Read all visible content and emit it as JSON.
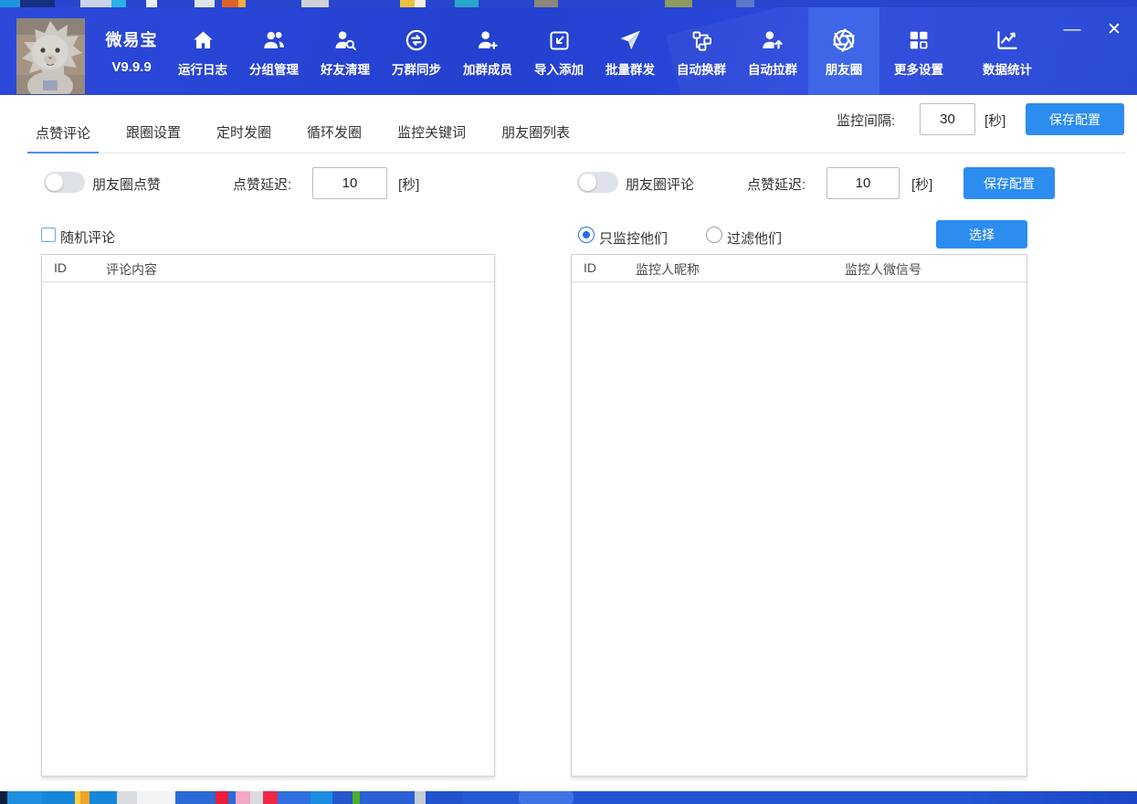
{
  "app": {
    "name": "微易宝",
    "version": "V9.9.9"
  },
  "window_controls": {
    "minimize": "—",
    "close": "✕"
  },
  "nav": {
    "items": [
      {
        "label": "运行日志",
        "icon": "home-icon",
        "active": false
      },
      {
        "label": "分组管理",
        "icon": "users-icon",
        "active": false
      },
      {
        "label": "好友清理",
        "icon": "user-search-icon",
        "active": false
      },
      {
        "label": "万群同步",
        "icon": "sync-icon",
        "active": false
      },
      {
        "label": "加群成员",
        "icon": "user-add-icon",
        "active": false
      },
      {
        "label": "导入添加",
        "icon": "import-icon",
        "active": false
      },
      {
        "label": "批量群发",
        "icon": "send-icon",
        "active": false
      },
      {
        "label": "自动换群",
        "icon": "nodes-icon",
        "active": false
      },
      {
        "label": "自动拉群",
        "icon": "user-up-icon",
        "active": false
      },
      {
        "label": "朋友圈",
        "icon": "aperture-icon",
        "active": true
      },
      {
        "label": "更多设置",
        "icon": "grid-icon",
        "active": false
      },
      {
        "label": "数据统计",
        "icon": "chart-icon",
        "active": false
      }
    ]
  },
  "tabs": [
    {
      "label": "点赞评论",
      "active": true
    },
    {
      "label": "跟圈设置",
      "active": false
    },
    {
      "label": "定时发圈",
      "active": false
    },
    {
      "label": "循环发圈",
      "active": false
    },
    {
      "label": "监控关键词",
      "active": false
    },
    {
      "label": "朋友圈列表",
      "active": false
    }
  ],
  "monitor_interval": {
    "label": "监控间隔:",
    "value": "30",
    "unit": "[秒]",
    "save_button": "保存配置"
  },
  "like_panel": {
    "toggle_label": "朋友圈点赞",
    "toggle_on": false,
    "delay_label": "点赞延迟:",
    "delay_value": "10",
    "delay_unit": "[秒]",
    "random_comment_label": "随机评论",
    "random_comment_checked": false,
    "table": {
      "columns": [
        "ID",
        "评论内容"
      ],
      "rows": []
    }
  },
  "comment_panel": {
    "toggle_label": "朋友圈评论",
    "toggle_on": false,
    "delay_label": "点赞延迟:",
    "delay_value": "10",
    "delay_unit": "[秒]",
    "save_button": "保存配置",
    "radio_options": [
      {
        "label": "只监控他们",
        "selected": true
      },
      {
        "label": "过滤他们",
        "selected": false
      }
    ],
    "select_button": "选择",
    "table": {
      "columns": [
        "ID",
        "监控人昵称",
        "监控人微信号"
      ],
      "rows": []
    }
  },
  "colors": {
    "header_blue": "#2845d8",
    "nav_active_blue": "#3f66e6",
    "accent_button_blue": "#2d8cf0",
    "tab_underline_blue": "#4a8df2"
  }
}
